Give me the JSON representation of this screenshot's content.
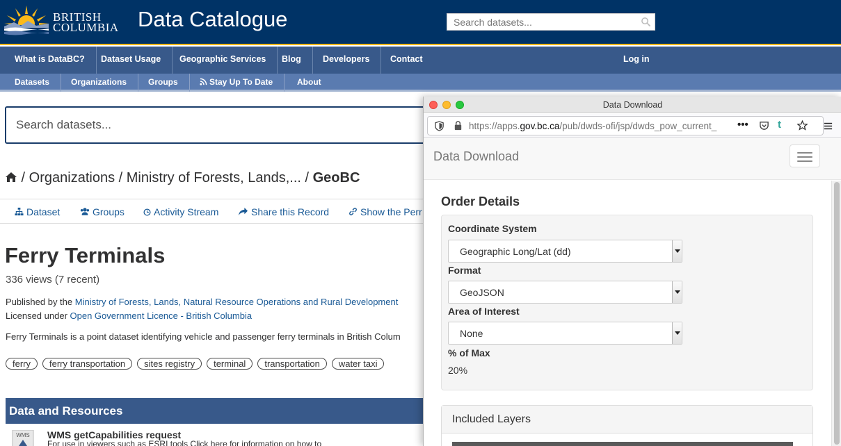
{
  "header": {
    "logo_line1": "BRITISH",
    "logo_line2": "COLUMBIA",
    "site_title": "Data Catalogue",
    "search_placeholder": "Search datasets..."
  },
  "nav_primary": {
    "items": [
      "What is DataBC?",
      "Dataset Usage",
      "Geographic Services",
      "Blog",
      "Developers",
      "Contact"
    ],
    "login": "Log in"
  },
  "nav_secondary": {
    "items": [
      "Datasets",
      "Organizations",
      "Groups",
      "Stay Up To Date",
      "About"
    ]
  },
  "main": {
    "search_placeholder": "Search datasets...",
    "breadcrumb": {
      "sep1": " / Organizations / Ministry of Forests, Lands,... / ",
      "current": "GeoBC"
    },
    "tabs": [
      "Dataset",
      "Groups",
      "Activity Stream",
      "Share this Record",
      "Show the Perr"
    ],
    "dataset_title": "Ferry Terminals",
    "views": "336 views (7 recent)",
    "published_prefix": "Published by the ",
    "published_org": "Ministry of Forests, Lands, Natural Resource Operations and Rural Development",
    "licensed_prefix": "Licensed under ",
    "license": "Open Government Licence - British Columbia",
    "description": "Ferry Terminals is a point dataset identifying vehicle and passenger ferry terminals in British Colum",
    "tags": [
      "ferry",
      "ferry transportation",
      "sites registry",
      "terminal",
      "transportation",
      "water taxi"
    ],
    "data_resources_heading": "Data and Resources",
    "resource": {
      "icon_label": "WMS",
      "title": "WMS getCapabilities request",
      "description": "For use in viewers such as ESRI tools Click here for information on how to"
    }
  },
  "popup": {
    "window_title": "Data Download",
    "url_prefix": "https://apps.",
    "url_domain": "gov.bc.ca",
    "url_rest": "/pub/dwds-ofi/jsp/dwds_pow_current_",
    "url_more": "•••",
    "tumblr": "t",
    "brand": "Data Download",
    "order_details": "Order Details",
    "coord_label": "Coordinate System",
    "coord_value": "Geographic Long/Lat (dd)",
    "format_label": "Format",
    "format_value": "GeoJSON",
    "aoi_label": "Area of Interest",
    "aoi_value": "None",
    "pct_label": "% of Max",
    "pct_value": "20%",
    "included_layers": "Included Layers"
  },
  "colors": {
    "header_bg": "#003366",
    "accent_gold": "#fcba19",
    "nav_primary_bg": "#38598a",
    "nav_secondary_bg": "#5a7bb0",
    "link": "#1a5a96"
  }
}
